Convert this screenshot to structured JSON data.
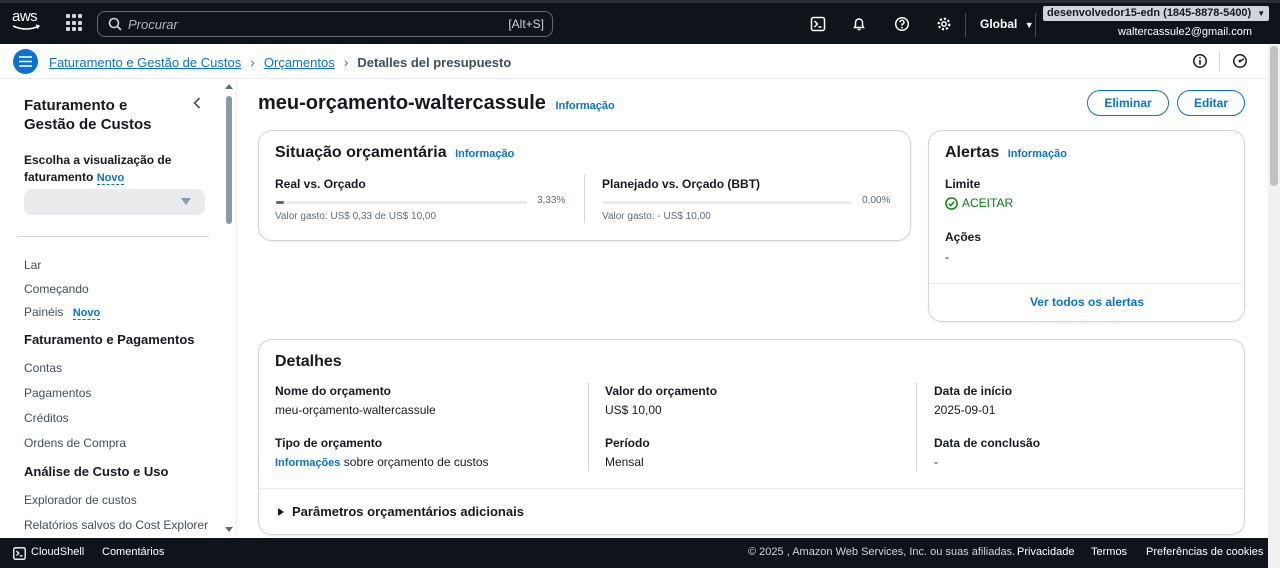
{
  "topnav": {
    "logo": "aws",
    "search_placeholder": "Procurar",
    "search_shortcut": "[Alt+S]",
    "region": "Global",
    "account": "desenvolvedor15-edn (1845-8878-5400)",
    "email": "waltercassule2@gmail.com"
  },
  "breadcrumb": {
    "items": [
      "Faturamento e Gestão de Custos",
      "Orçamentos"
    ],
    "current": "Detalles del presupuesto"
  },
  "sidebar": {
    "title": "Faturamento e Gestão de Custos",
    "choose_label": "Escolha a visualização de faturamento",
    "new_badge": "Novo",
    "links_top": [
      "Lar",
      "Começando",
      "Painéis"
    ],
    "section1": "Faturamento e Pagamentos",
    "section1_links": [
      "Contas",
      "Pagamentos",
      "Créditos",
      "Ordens de Compra"
    ],
    "section2": "Análise de Custo e Uso",
    "section2_links": [
      "Explorador de custos",
      "Relatórios salvos do Cost Explorer"
    ]
  },
  "page": {
    "title": "meu-orçamento-waltercassule",
    "info": "Informação",
    "delete_label": "Eliminar",
    "edit_label": "Editar"
  },
  "status_card": {
    "title": "Situação orçamentária",
    "info": "Informação",
    "actual_label": "Real vs. Orçado",
    "actual_pct": "3,33%",
    "actual_fraction": 0.0333,
    "actual_spent": "Valor gasto: US$ 0,33 de US$ 10,00",
    "planned_label": "Planejado vs. Orçado (BBT)",
    "planned_pct": "0,00%",
    "planned_fraction": 0,
    "planned_spent": "Valor gasto: - US$ 10,00"
  },
  "alerts_card": {
    "title": "Alertas",
    "info": "Informação",
    "limit_label": "Limite",
    "limit_value": "ACEITAR",
    "actions_label": "Ações",
    "actions_value": "-",
    "view_all": "Ver todos os alertas"
  },
  "details_card": {
    "title": "Detalhes",
    "name_label": "Nome do orçamento",
    "name_value": "meu-orçamento-waltercassule",
    "amount_label": "Valor do orçamento",
    "amount_value": "US$ 10,00",
    "start_label": "Data de início",
    "start_value": "2025-09-01",
    "type_label": "Tipo de orçamento",
    "type_link": "Informações",
    "type_value": "sobre orçamento de custos",
    "period_label": "Período",
    "period_value": "Mensal",
    "end_label": "Data de conclusão",
    "end_value": "-",
    "extra_params": "Parâmetros orçamentários adicionais"
  },
  "footer": {
    "cloudshell": "CloudShell",
    "feedback": "Comentários",
    "copyright": "© 2025 , Amazon Web Services, Inc. ou suas afiliadas.",
    "privacy": "Privacidade",
    "terms": "Termos",
    "cookies": "Preferências de cookies"
  }
}
